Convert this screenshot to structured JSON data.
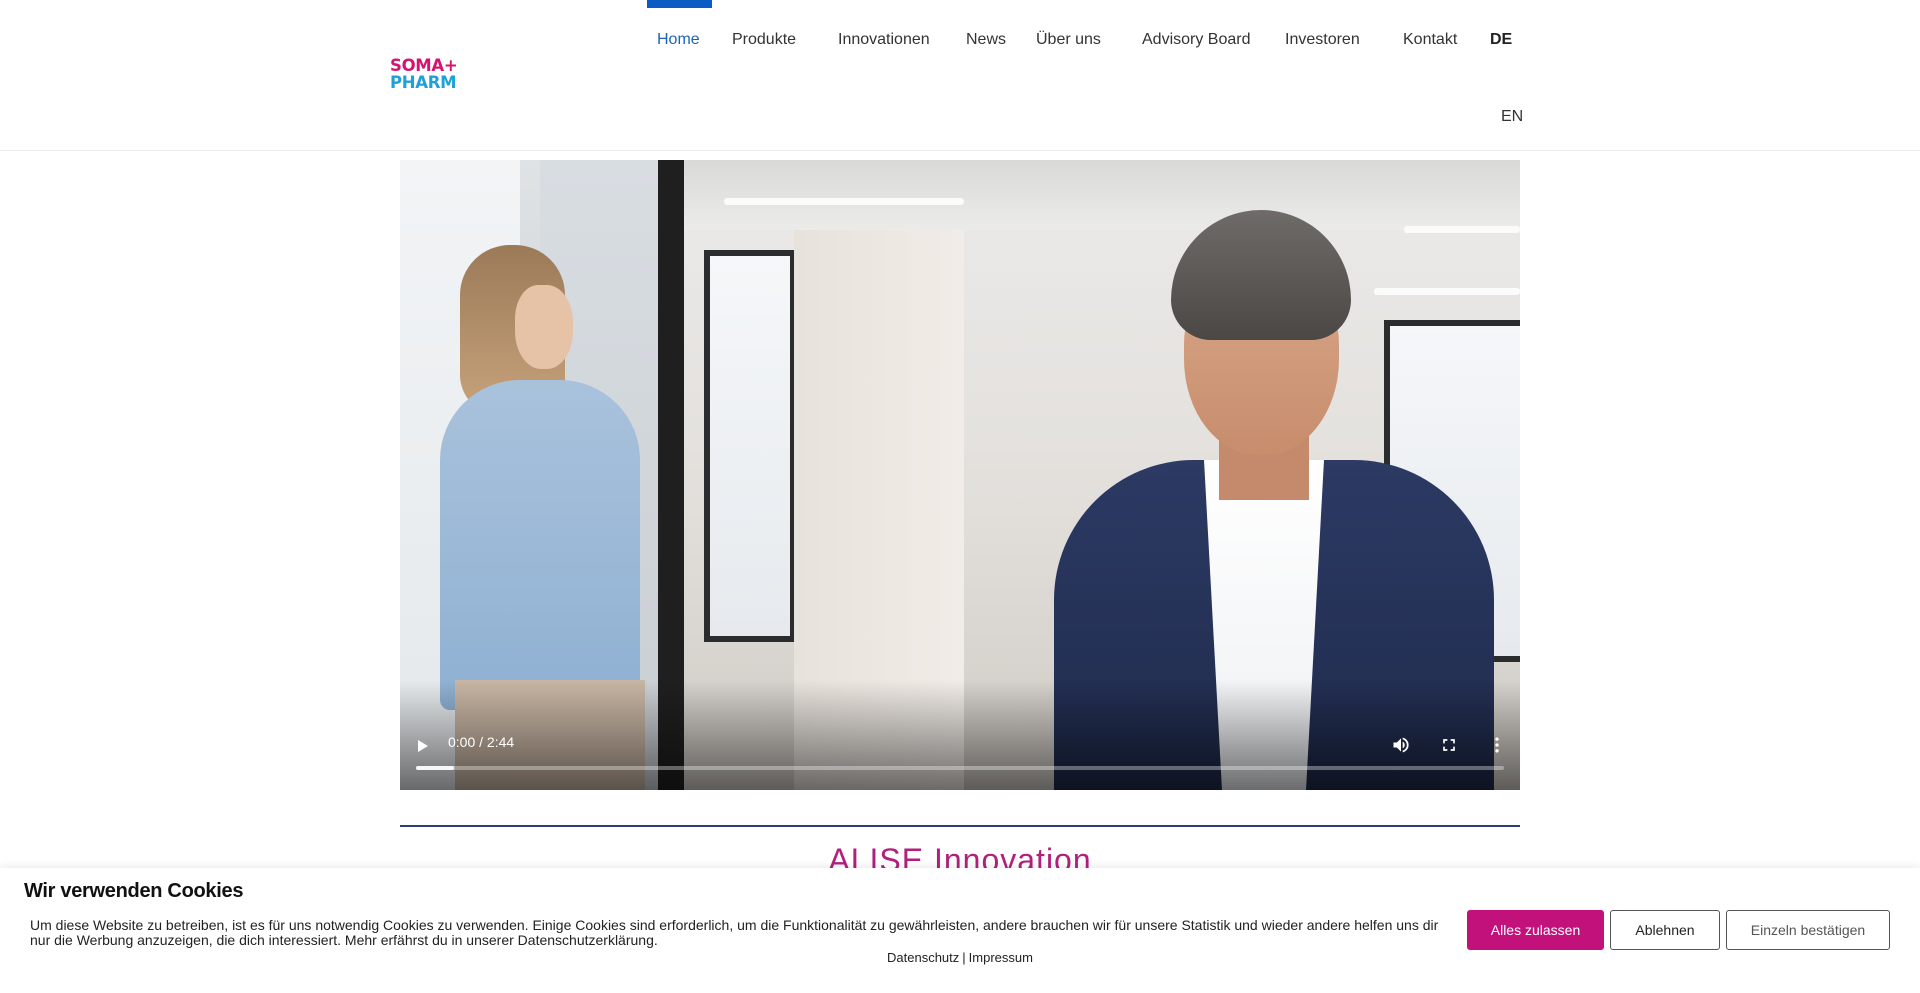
{
  "brand": {
    "logo_line1": "SOMA+",
    "logo_line2": "PHARM"
  },
  "nav": {
    "items": [
      {
        "label": "Home"
      },
      {
        "label": "Produkte"
      },
      {
        "label": "Innovationen"
      },
      {
        "label": "News"
      },
      {
        "label": "Über uns"
      },
      {
        "label": "Advisory Board"
      },
      {
        "label": "Investoren"
      },
      {
        "label": "Kontakt"
      }
    ],
    "active_index": 0,
    "lang_current": "DE",
    "lang_other": "EN"
  },
  "video": {
    "time": "0:00 / 2:44",
    "progress_fraction": 0.035,
    "icons": [
      "play-icon",
      "volume-icon",
      "fullscreen-icon",
      "more-options-icon"
    ]
  },
  "section": {
    "heading": "ALISE Innovation"
  },
  "cookie": {
    "title": "Wir verwenden Cookies",
    "text": "Um diese Website zu betreiben, ist es für uns notwendig Cookies zu verwenden. Einige Cookies sind erforderlich, um die Funktionalität zu gewährleisten, andere brauchen wir für unsere Statistik und wieder andere helfen uns dir nur die Werbung anzuzeigen, die dich interessiert. Mehr erfährst du in unserer Datenschutzerklärung.",
    "accept_label": "Alles zulassen",
    "decline_label": "Ablehnen",
    "confirm_label": "Einzeln bestätigen",
    "link_privacy": "Datenschutz",
    "link_separator": "|",
    "link_imprint": "Impressum"
  },
  "colors": {
    "brand_magenta": "#c3117c",
    "brand_cyan": "#1fa0d8",
    "nav_active": "#1a64b4",
    "rule_navy": "#2f3d72"
  }
}
